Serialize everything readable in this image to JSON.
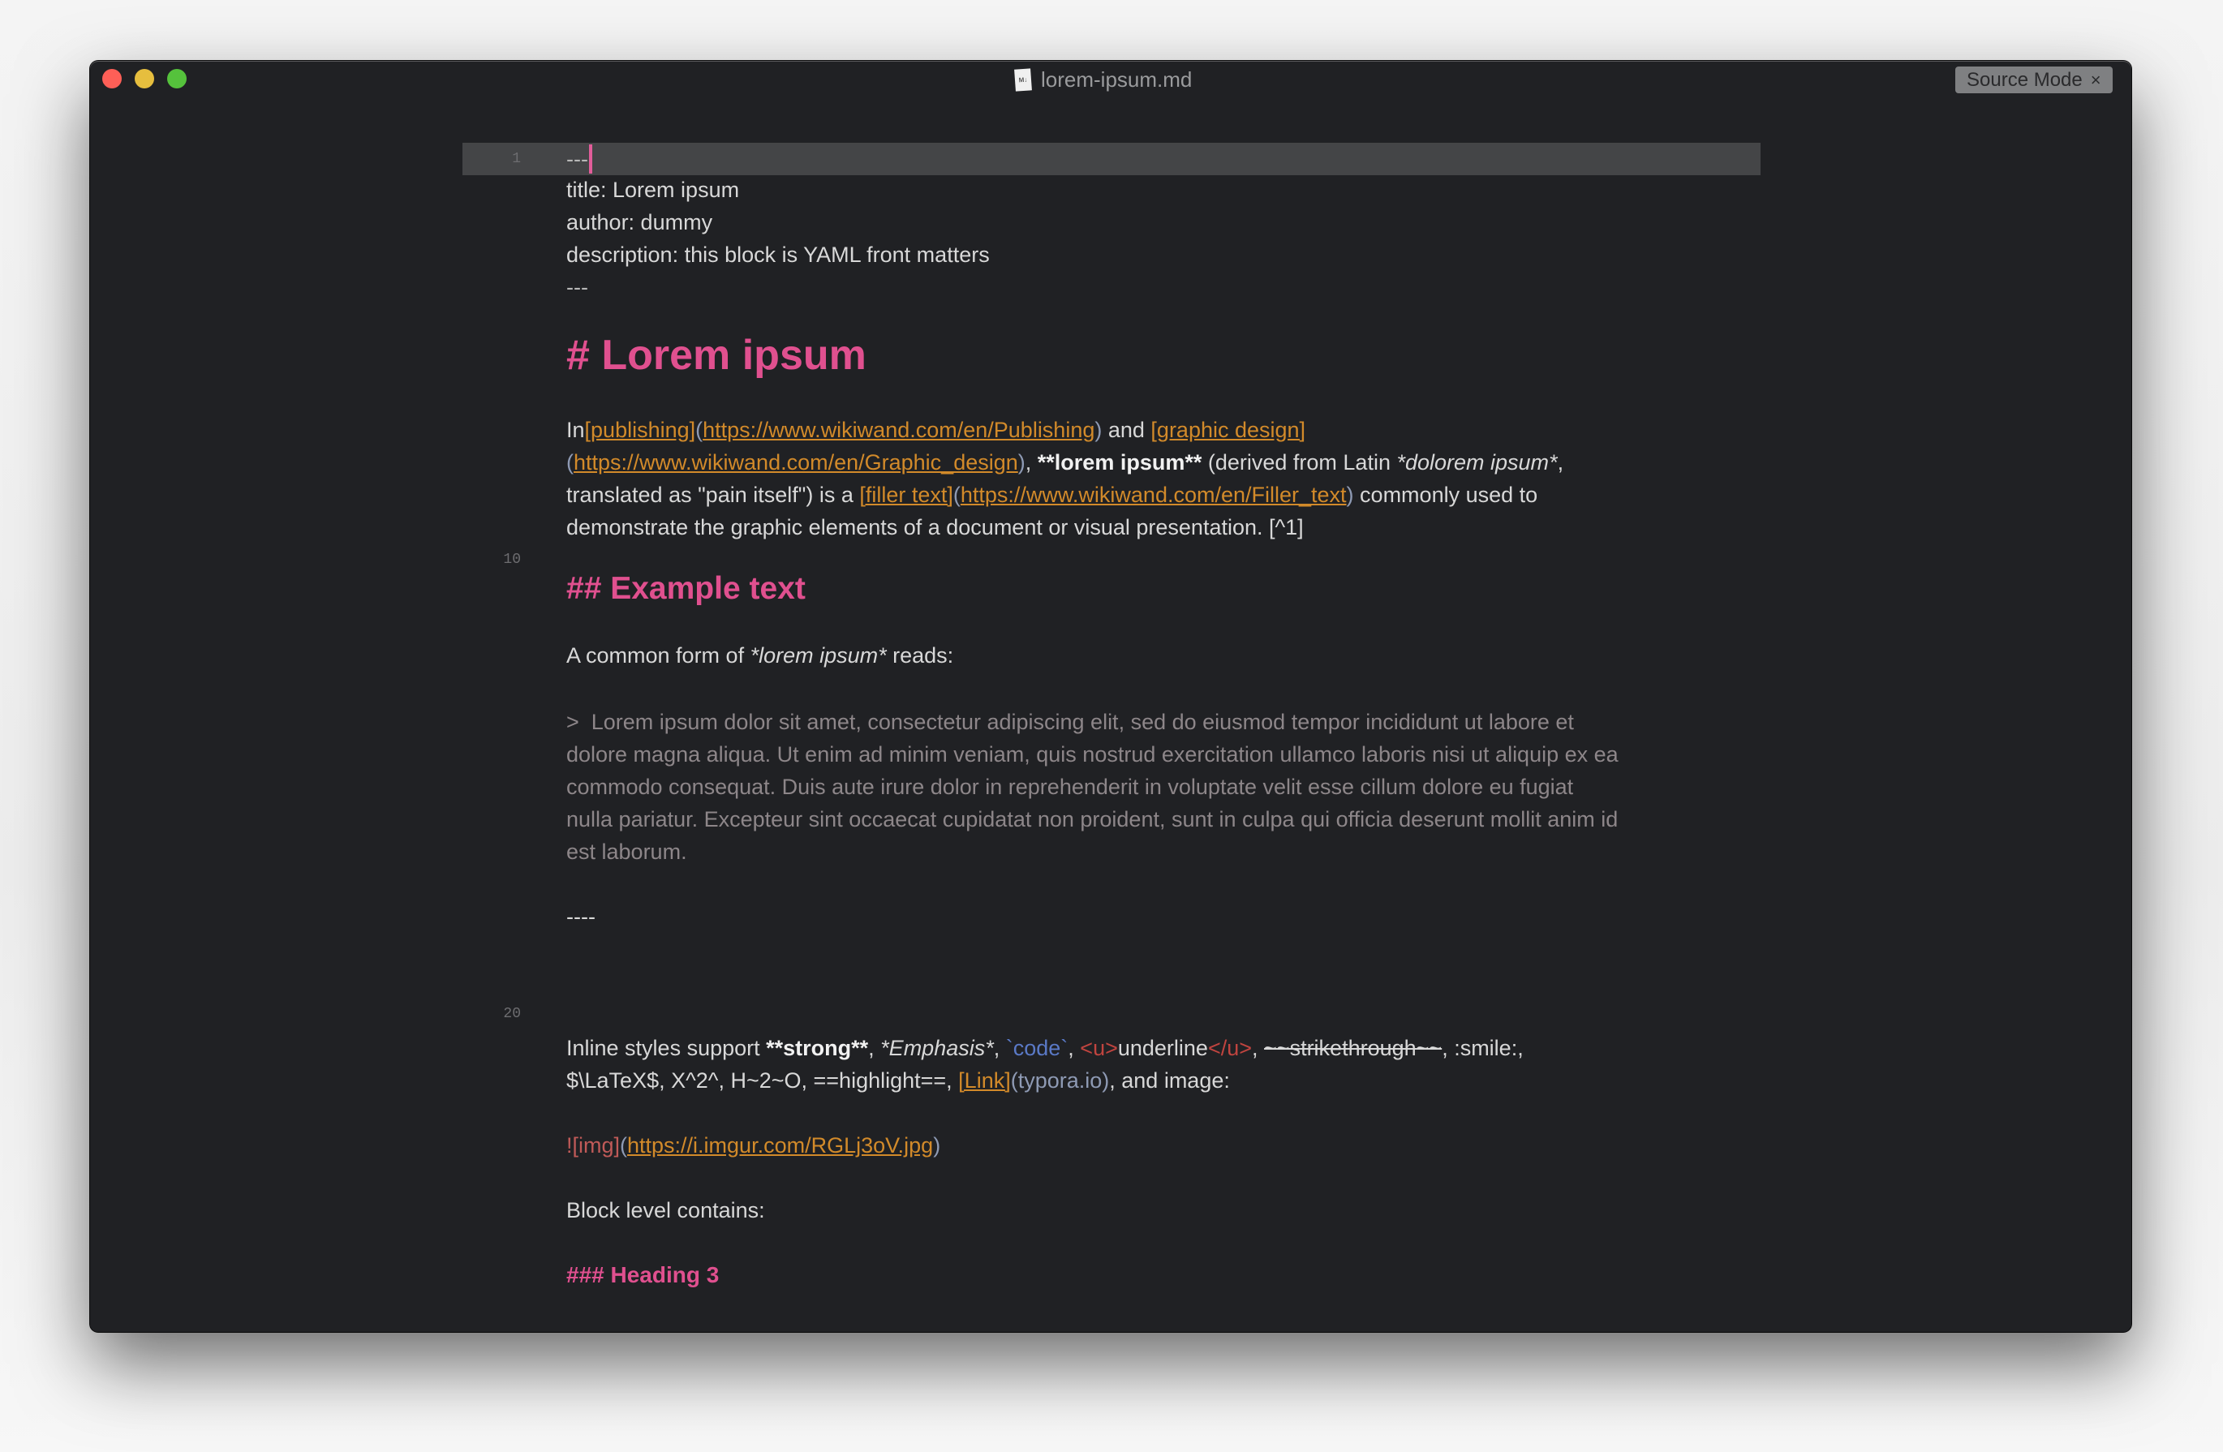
{
  "window": {
    "title": "lorem-ipsum.md",
    "file_icon_label": "M↓",
    "source_mode_badge": {
      "label": "Source Mode",
      "close_glyph": "×"
    },
    "traffic_lights": {
      "close": "#fe5f57",
      "minimize": "#e6be3e",
      "maximize": "#55c23c"
    }
  },
  "theme": {
    "background": "#202124",
    "active_line": "#444547",
    "heading": "#e0508f",
    "link": "#d28a2a",
    "paren": "#8e9ab4",
    "code": "#5a79c6",
    "html_tag": "#c0443f",
    "quote": "#8d8689",
    "cursor": "#e25d9a"
  },
  "gutter": {
    "line_numbers": [
      "1",
      "10",
      "20"
    ]
  },
  "document": {
    "front_matter": {
      "open": "---",
      "title_line": "title: Lorem ipsum",
      "author_line": "author: dummy",
      "description_line": "description: this block is YAML front matters",
      "close": "---"
    },
    "h1": "# Lorem ipsum",
    "para1": {
      "l1_a": "In ",
      "l1_link1_text": "[publishing]",
      "l1_link1_open": "(",
      "l1_link1_url": "https://www.wikiwand.com/en/Publishing",
      "l1_link1_close": ")",
      "l1_b": " and ",
      "l1_link2_text": "[graphic design]",
      "l2_link2_open": "(",
      "l2_link2_url": "https://www.wikiwand.com/en/Graphic_design",
      "l2_link2_close": ")",
      "l2_a": ", ",
      "l2_bold": "**lorem ipsum**",
      "l2_b": " (derived from Latin ",
      "l2_ital": "*dolorem ipsum*",
      "l2_c": ",",
      "l3_a": "translated as \"pain itself\") is a ",
      "l3_link3_text": "[filler text]",
      "l3_link3_open": "(",
      "l3_link3_url": "https://www.wikiwand.com/en/Filler_text",
      "l3_link3_close": ")",
      "l3_b": " commonly used to",
      "l4": "demonstrate the graphic elements of a document or visual presentation. [^1]"
    },
    "h2": "## Example text",
    "common_form": {
      "a": "A common form of ",
      "ital": "*lorem ipsum*",
      "b": " reads:"
    },
    "blockquote": [
      ">  Lorem ipsum dolor sit amet, consectetur adipiscing elit, sed do eiusmod tempor incididunt ut labore et",
      "dolore magna aliqua. Ut enim ad minim veniam, quis nostrud exercitation ullamco laboris nisi ut aliquip ex ea",
      "commodo consequat. Duis aute irure dolor in reprehenderit in voluptate velit esse cillum dolore eu fugiat",
      "nulla pariatur. Excepteur sint occaecat cupidatat non proident, sunt in culpa qui officia deserunt mollit anim id",
      "est laborum."
    ],
    "hr": "----",
    "inline": {
      "a": "Inline styles support ",
      "strong": "**strong**",
      "sep1": ", ",
      "em": "*Emphasis*",
      "sep2": ", ",
      "code": "`code`",
      "sep3": ", ",
      "u_open": "<u>",
      "u_text": "underline",
      "u_close": "</u>",
      "sep4": ", ",
      "strike": "~~strikethrough~~",
      "tail1": ", :smile:,",
      "l2_a": "$\\LaTeX$, X^2^, H~2~O, ==highlight==, ",
      "link_text": "[Link]",
      "link_url": "(typora.io)",
      "l2_b": ", and image:"
    },
    "image_line": {
      "mark": "![img]",
      "open": "(",
      "url": "https://i.imgur.com/RGLj3oV.jpg",
      "close": ")"
    },
    "block_level": "Block level contains:",
    "h3": "### Heading 3"
  }
}
